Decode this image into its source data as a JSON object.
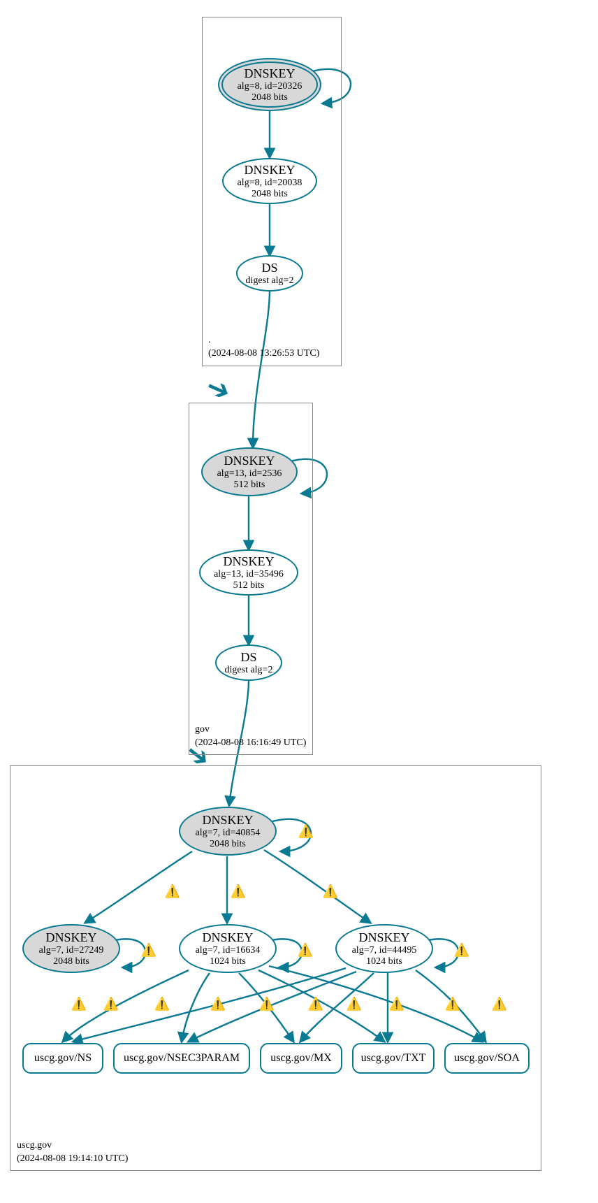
{
  "zones": {
    "root": {
      "name": ".",
      "timestamp": "(2024-08-08 13:26:53 UTC)",
      "dnskey_ksk": {
        "title": "DNSKEY",
        "line2": "alg=8, id=20326",
        "line3": "2048 bits"
      },
      "dnskey_zsk": {
        "title": "DNSKEY",
        "line2": "alg=8, id=20038",
        "line3": "2048 bits"
      },
      "ds": {
        "title": "DS",
        "line2": "digest alg=2"
      }
    },
    "gov": {
      "name": "gov",
      "timestamp": "(2024-08-08 16:16:49 UTC)",
      "dnskey_ksk": {
        "title": "DNSKEY",
        "line2": "alg=13, id=2536",
        "line3": "512 bits"
      },
      "dnskey_zsk": {
        "title": "DNSKEY",
        "line2": "alg=13, id=35496",
        "line3": "512 bits"
      },
      "ds": {
        "title": "DS",
        "line2": "digest alg=2"
      }
    },
    "uscg": {
      "name": "uscg.gov",
      "timestamp": "(2024-08-08 19:14:10 UTC)",
      "dnskey_ksk": {
        "title": "DNSKEY",
        "line2": "alg=7, id=40854",
        "line3": "2048 bits"
      },
      "dnskey_k2": {
        "title": "DNSKEY",
        "line2": "alg=7, id=27249",
        "line3": "2048 bits"
      },
      "dnskey_z1": {
        "title": "DNSKEY",
        "line2": "alg=7, id=16634",
        "line3": "1024 bits"
      },
      "dnskey_z2": {
        "title": "DNSKEY",
        "line2": "alg=7, id=44495",
        "line3": "1024 bits"
      },
      "rrset_ns": "uscg.gov/NS",
      "rrset_nsec3param": "uscg.gov/NSEC3PARAM",
      "rrset_mx": "uscg.gov/MX",
      "rrset_txt": "uscg.gov/TXT",
      "rrset_soa": "uscg.gov/SOA"
    }
  },
  "icons": {
    "warn": "⚠️"
  }
}
